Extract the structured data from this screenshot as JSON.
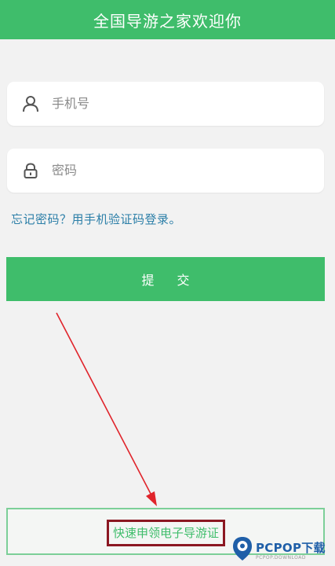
{
  "header": {
    "title": "全国导游之家欢迎你"
  },
  "form": {
    "phone_placeholder": "手机号",
    "phone_icon": "user-icon",
    "password_placeholder": "密码",
    "password_icon": "lock-icon",
    "forgot_link": "忘记密码？用手机验证码登录。",
    "submit_label": "提 交"
  },
  "footer": {
    "apply_link": "快速申领电子导游证"
  },
  "watermark": {
    "brand": "PCPOP下载",
    "tagline": "PCPOP.DOWNLOAD"
  },
  "colors": {
    "brand_green": "#3fbd6b",
    "link_blue": "#2c7fa8",
    "annotation_red": "#e0242b",
    "highlight_box": "#8b1822",
    "background": "#f2f2f2"
  }
}
